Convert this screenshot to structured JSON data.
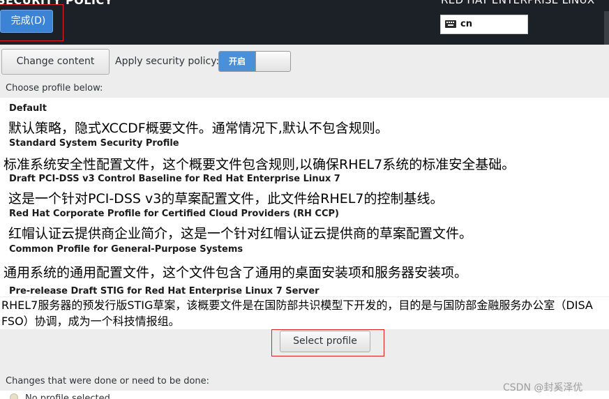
{
  "header": {
    "spoke_title": "SECURITY POLICY",
    "product_title": "RED HAT ENTERPRISE LINUX",
    "done_button_label": "完成(D)",
    "keyboard_layout": "cn"
  },
  "controls": {
    "change_content_label": "Change content",
    "apply_policy_label": "Apply security policy:",
    "toggle_state_label": "开启",
    "toggle_on": true
  },
  "profiles": {
    "heading": "Choose profile below:",
    "items": [
      {
        "title": "Default",
        "note": "默认策略，隐式XCCDF概要文件。通常情况下,默认不包含规则。"
      },
      {
        "title": "Standard System Security Profile",
        "note": "标准系统安全性配置文件，这个概要文件包含规则,以确保RHEL7系统的标准安全基础。"
      },
      {
        "title": "Draft PCI-DSS v3 Control Baseline for Red Hat Enterprise Linux 7",
        "note": "这是一个针对PCI-DSS v3的草案配置文件，此文件给RHEL7的控制基线。"
      },
      {
        "title": "Red Hat Corporate Profile for Certified Cloud Providers (RH CCP)",
        "note": "红帽认证云提供商企业简介，这是一个针对红帽认证云提供商的草案配置文件。"
      },
      {
        "title": "Common Profile for General-Purpose Systems",
        "note": "通用系统的通用配置文件，这个文件包含了通用的桌面安装项和服务器安装项。"
      },
      {
        "title": "Pre-release Draft STIG for Red Hat Enterprise Linux 7 Server",
        "note": "RHEL7服务器的预发行版STIG草案，该概要文件是在国防部共识模型下开发的，目的是与国防部金融服务办公室（DISA FSO）协调，成为一个科技情报组。"
      }
    ]
  },
  "select_profile_label": "Select profile",
  "changes": {
    "heading": "Changes that were done or need to be done:",
    "item_text": "No profile selected"
  },
  "watermark": "CSDN @封奚泽优",
  "colors": {
    "header_bg": "#1b2127",
    "accent_blue": "#3d83d5",
    "annotation_red": "#e02020"
  }
}
